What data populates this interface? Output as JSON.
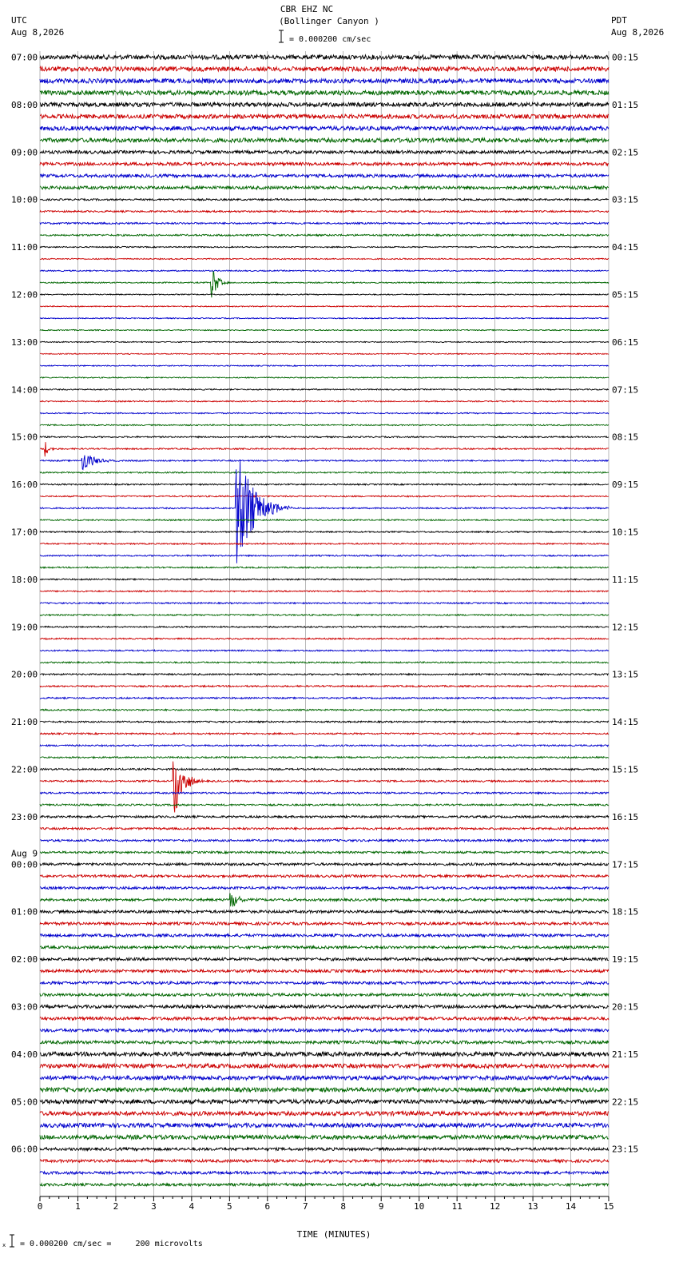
{
  "header": {
    "station": "CBR EHZ NC",
    "location": "(Bollinger Canyon )",
    "scale": "= 0.000200 cm/sec",
    "left_tz": "UTC",
    "left_date": "Aug 8,2026",
    "right_tz": "PDT",
    "right_date": "Aug 8,2026"
  },
  "footer": {
    "scale_note": "= 0.000200 cm/sec =     200 microvolts"
  },
  "chart_data": {
    "type": "line",
    "title": "CBR EHZ NC (Bollinger Canyon )",
    "xlabel": "TIME (MINUTES)",
    "xlim": [
      0,
      15
    ],
    "x_ticks": [
      "0",
      "1",
      "2",
      "3",
      "4",
      "5",
      "6",
      "7",
      "8",
      "9",
      "10",
      "11",
      "12",
      "13",
      "14",
      "15"
    ],
    "traces_per_hour": 4,
    "trace_colors": [
      "#000000",
      "#cc0000",
      "#0000cc",
      "#006600"
    ],
    "left_labels": [
      "07:00",
      "08:00",
      "09:00",
      "10:00",
      "11:00",
      "12:00",
      "13:00",
      "14:00",
      "15:00",
      "16:00",
      "17:00",
      "18:00",
      "19:00",
      "20:00",
      "21:00",
      "22:00",
      "23:00",
      "00:00",
      "01:00",
      "02:00",
      "03:00",
      "04:00",
      "05:00",
      "06:00"
    ],
    "date_change_label": "Aug 9",
    "date_change_index": 17,
    "right_labels": [
      "00:15",
      "01:15",
      "02:15",
      "03:15",
      "04:15",
      "05:15",
      "06:15",
      "07:15",
      "08:15",
      "09:15",
      "10:15",
      "11:15",
      "12:15",
      "13:15",
      "14:15",
      "15:15",
      "16:15",
      "17:15",
      "18:15",
      "19:15",
      "20:15",
      "21:15",
      "22:15",
      "23:15"
    ],
    "noise_by_hour": [
      1.3,
      1.2,
      0.9,
      0.5,
      0.35,
      0.3,
      0.3,
      0.35,
      0.4,
      0.4,
      0.4,
      0.4,
      0.4,
      0.45,
      0.45,
      0.5,
      0.6,
      0.7,
      0.8,
      0.8,
      0.9,
      1.2,
      1.2,
      0.8
    ],
    "events": [
      {
        "trace": 19,
        "minute": 4.5,
        "amp": 2.2,
        "dur": 0.5
      },
      {
        "trace": 33,
        "minute": 0.1,
        "amp": 1.0,
        "dur": 0.4
      },
      {
        "trace": 34,
        "minute": 1.1,
        "amp": 1.2,
        "dur": 1.0
      },
      {
        "trace": 38,
        "minute": 5.15,
        "amp": 6.5,
        "dur": 1.5
      },
      {
        "trace": 61,
        "minute": 3.5,
        "amp": 4.5,
        "dur": 0.8
      },
      {
        "trace": 71,
        "minute": 5.0,
        "amp": 1.2,
        "dur": 0.6
      }
    ]
  }
}
